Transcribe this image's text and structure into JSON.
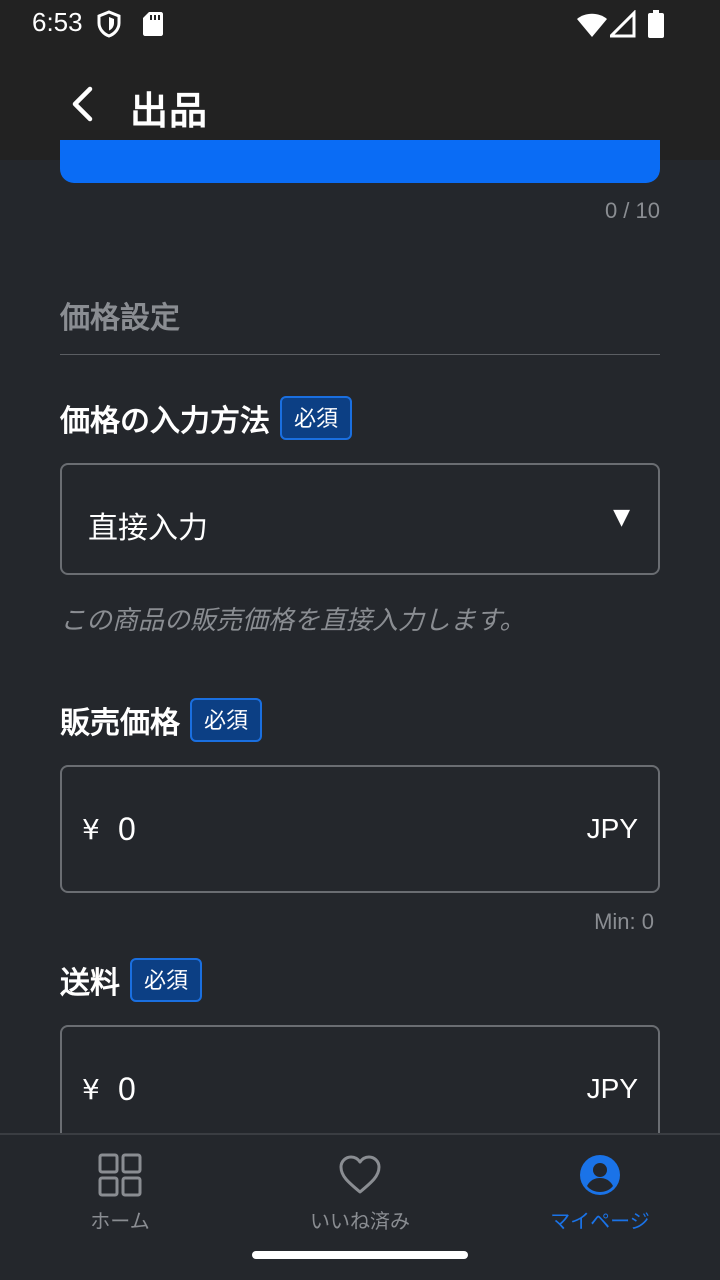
{
  "status_bar": {
    "time": "6:53"
  },
  "app_bar": {
    "title": "出品"
  },
  "photo_counter": "0 / 10",
  "section": {
    "title": "価格設定"
  },
  "price_method": {
    "label": "価格の入力方法",
    "badge": "必須",
    "selected": "直接入力",
    "arrow": "▼",
    "helper": "この商品の販売価格を直接入力します。"
  },
  "sale_price": {
    "label": "販売価格",
    "badge": "必須",
    "currency_symbol": "¥",
    "value": "0",
    "unit": "JPY",
    "min": "Min: 0"
  },
  "shipping": {
    "label": "送料",
    "badge": "必須",
    "currency_symbol": "¥",
    "value": "0",
    "unit": "JPY"
  },
  "bottom_nav": {
    "items": [
      {
        "label": "ホーム",
        "icon": "grid-icon",
        "active": false
      },
      {
        "label": "いいね済み",
        "icon": "heart-icon",
        "active": false
      },
      {
        "label": "マイページ",
        "icon": "account-circle-icon",
        "active": true
      }
    ]
  },
  "colors": {
    "accent": "#1a73e8",
    "primary_button": "#0a6cf5",
    "background": "#24272c",
    "badge_bg": "#0c3f84"
  }
}
